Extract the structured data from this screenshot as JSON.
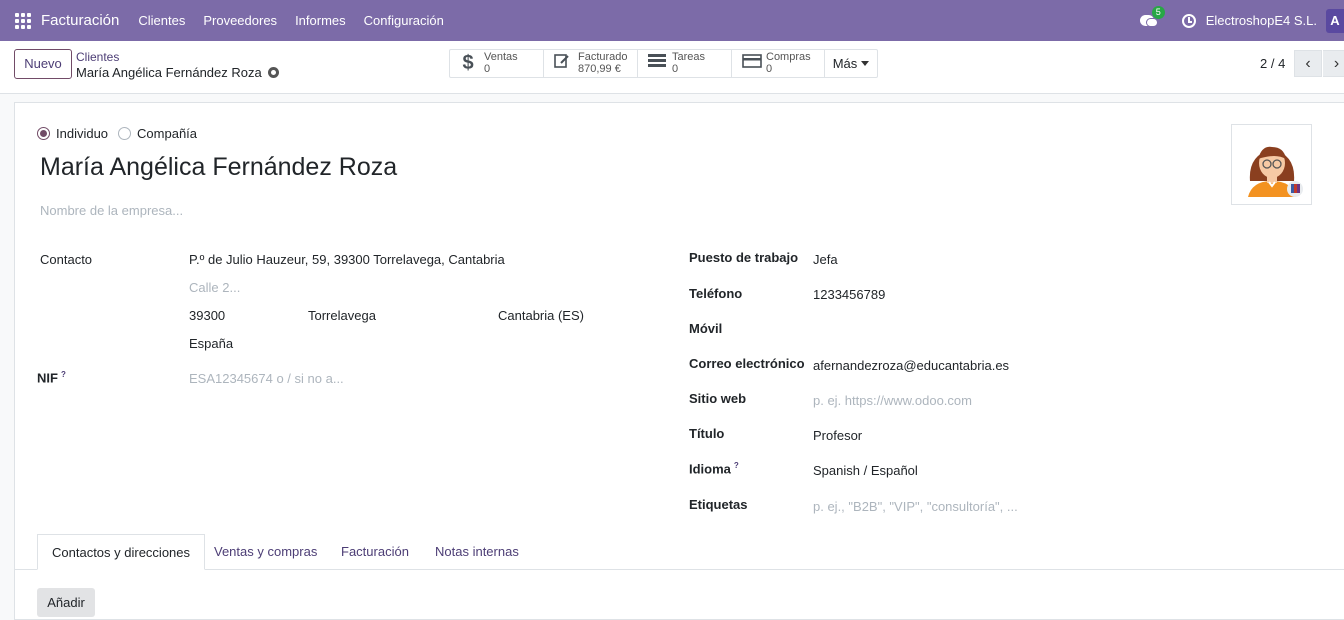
{
  "navbar": {
    "brand": "Facturación",
    "menu": [
      "Clientes",
      "Proveedores",
      "Informes",
      "Configuración"
    ],
    "messages_count": "5",
    "company": "ElectroshopE4 S.L.",
    "user_initial": "A"
  },
  "control": {
    "new_label": "Nuevo",
    "breadcrumb_parent": "Clientes",
    "breadcrumb_current": "María Angélica Fernández Roza",
    "smart_buttons": [
      {
        "label": "Ventas",
        "value": "0",
        "icon": "dollar-icon"
      },
      {
        "label": "Facturado",
        "value": "870,99 €",
        "icon": "invoice-edit-icon"
      },
      {
        "label": "Tareas",
        "value": "0",
        "icon": "tasks-icon"
      },
      {
        "label": "Compras",
        "value": "0",
        "icon": "credit-card-icon"
      }
    ],
    "more_label": "Más",
    "pager": "2 / 4"
  },
  "form": {
    "type_options": [
      "Individuo",
      "Compañía"
    ],
    "type_selected": "Individuo",
    "name": "María Angélica Fernández Roza",
    "company_placeholder": "Nombre de la empresa...",
    "contact_label": "Contacto",
    "street": "P.º de Julio Hauzeur, 59, 39300 Torrelavega, Cantabria",
    "street2_placeholder": "Calle 2...",
    "zip": "39300",
    "city": "Torrelavega",
    "state": "Cantabria (ES)",
    "country": "España",
    "nif_label": "NIF",
    "nif_help": "?",
    "nif_placeholder": "ESA12345674 o / si no a...",
    "right_fields": {
      "job_label": "Puesto de trabajo",
      "job_value": "Jefa",
      "phone_label": "Teléfono",
      "phone_value": "1233456789",
      "mobile_label": "Móvil",
      "mobile_value": "",
      "email_label": "Correo electrónico",
      "email_value": "afernandezroza@educantabria.es",
      "web_label": "Sitio web",
      "web_placeholder": "p. ej. https://www.odoo.com",
      "title_label": "Título",
      "title_value": "Profesor",
      "lang_label": "Idioma",
      "lang_help": "?",
      "lang_value": "Spanish / Español",
      "tags_label": "Etiquetas",
      "tags_placeholder": "p. ej., \"B2B\", \"VIP\", \"consultoría\", ..."
    }
  },
  "tabs": [
    "Contactos y direcciones",
    "Ventas y compras",
    "Facturación",
    "Notas internas"
  ],
  "add_label": "Añadir"
}
